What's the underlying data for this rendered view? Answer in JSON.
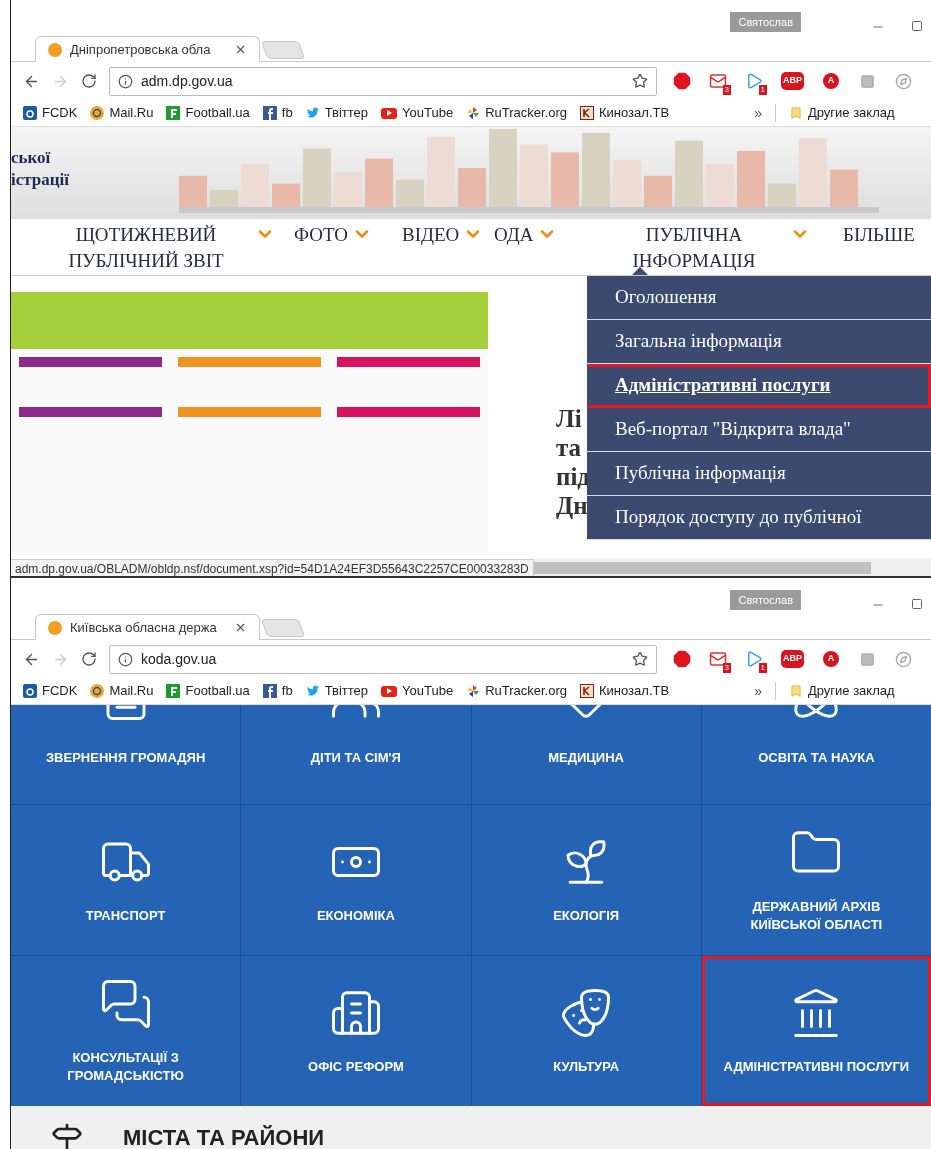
{
  "windows": [
    {
      "profile": "Святослав",
      "tab": {
        "title": "Дніпропетровська обла"
      },
      "address": "adm.dp.gov.ua",
      "extensions": [
        {
          "kind": "opera"
        },
        {
          "kind": "mail",
          "badge": "3"
        },
        {
          "kind": "player",
          "badge": "1"
        },
        {
          "kind": "abp",
          "label": "ABP"
        },
        {
          "kind": "adblock",
          "label": "A"
        },
        {
          "kind": "play"
        },
        {
          "kind": "compass"
        }
      ],
      "bookmarks": [
        {
          "kind": "fcdk",
          "label": "FCDK"
        },
        {
          "kind": "mail",
          "label": "Mail.Ru"
        },
        {
          "kind": "football",
          "label": "Football.ua"
        },
        {
          "kind": "facebook",
          "label": "fb"
        },
        {
          "kind": "twitter",
          "label": "Твіттер"
        },
        {
          "kind": "youtube",
          "label": "YouTube"
        },
        {
          "kind": "tracker",
          "label": "RuTracker.org"
        },
        {
          "kind": "kinozal",
          "label": "Кинозал.ТВ"
        }
      ],
      "more": "»",
      "other_bookmarks": "Другие заклад"
    },
    {
      "profile": "Святослав",
      "tab": {
        "title": "Київська обласна держа"
      },
      "address": "koda.gov.ua",
      "extensions": [
        {
          "kind": "opera"
        },
        {
          "kind": "mail",
          "badge": "3"
        },
        {
          "kind": "player",
          "badge": "1"
        },
        {
          "kind": "abp",
          "label": "ABP"
        },
        {
          "kind": "adblock",
          "label": "A"
        },
        {
          "kind": "play"
        },
        {
          "kind": "compass"
        }
      ],
      "bookmarks": [
        {
          "kind": "fcdk",
          "label": "FCDK"
        },
        {
          "kind": "mail",
          "label": "Mail.Ru"
        },
        {
          "kind": "football",
          "label": "Football.ua"
        },
        {
          "kind": "facebook",
          "label": "fb"
        },
        {
          "kind": "twitter",
          "label": "Твіттер"
        },
        {
          "kind": "youtube",
          "label": "YouTube"
        },
        {
          "kind": "tracker",
          "label": "RuTracker.org"
        },
        {
          "kind": "kinozal",
          "label": "Кинозал.ТВ"
        }
      ],
      "more": "»",
      "other_bookmarks": "Другие заклад"
    }
  ],
  "dp_page": {
    "banner_texts": [
      "ської",
      "істрації"
    ],
    "nav": [
      {
        "label": "ЩОТИЖНЕВИЙ ПУБЛІЧНИЙ ЗВІТ",
        "expanded": false
      },
      {
        "label": "ФОТО",
        "expanded": false
      },
      {
        "label": "ВІДЕО",
        "expanded": false
      },
      {
        "label": "ОДА",
        "expanded": false
      },
      {
        "label": "ПУБЛІЧНА ІНФОРМАЦІЯ",
        "expanded": true
      },
      {
        "label": "БІЛЬШЕ",
        "expanded": false
      }
    ],
    "dropdown": [
      {
        "label": "Оголошення",
        "highlighted": false
      },
      {
        "label": "Загальна інформація",
        "highlighted": false
      },
      {
        "label": "Адміністративні послуги",
        "highlighted": true
      },
      {
        "label": "Веб-портал \"Відкрита влада\"",
        "highlighted": false
      },
      {
        "label": "Публічна інформація",
        "highlighted": false
      },
      {
        "label": "Порядок доступу до публічної",
        "highlighted": false
      }
    ],
    "headline_fragments": [
      "Лі",
      "та",
      "під",
      "Дн"
    ],
    "status_url": "adm.dp.gov.ua/OBLADM/obldp.nsf/document.xsp?id=54D1A24EF3D55643C2257CE00033283D"
  },
  "koda_page": {
    "tiles": [
      {
        "label": "ЗВЕРНЕННЯ ГРОМАДЯН",
        "highlighted": false
      },
      {
        "label": "ДІТИ ТА СІМ'Я",
        "highlighted": false
      },
      {
        "label": "МЕДИЦИНА",
        "highlighted": false
      },
      {
        "label": "ОСВІТА ТА НАУКА",
        "highlighted": false
      },
      {
        "label": "ТРАНСПОРТ",
        "highlighted": false
      },
      {
        "label": "ЕКОНОМІКА",
        "highlighted": false
      },
      {
        "label": "ЕКОЛОГІЯ",
        "highlighted": false
      },
      {
        "label": "ДЕРЖАВНИЙ АРХІВ КИЇВСЬКОЇ ОБЛАСТІ",
        "highlighted": false
      },
      {
        "label": "КОНСУЛЬТАЦІЇ З ГРОМАДСЬКІСТЮ",
        "highlighted": false
      },
      {
        "label": "ОФІС РЕФОРМ",
        "highlighted": false
      },
      {
        "label": "КУЛЬТУРА",
        "highlighted": false
      },
      {
        "label": "АДМІНІСТРАТИВНІ ПОСЛУГИ",
        "highlighted": true
      }
    ],
    "section_title": "МІСТА ТА РАЙОНИ"
  }
}
